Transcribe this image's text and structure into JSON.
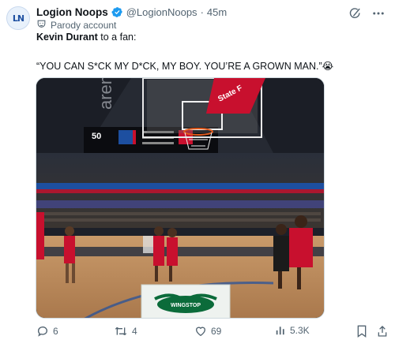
{
  "tweet": {
    "author": {
      "display_name": "Logion Noops",
      "handle": "@LogionNoops",
      "separator": "·",
      "time": "45m",
      "avatar_logo": "LN",
      "verified_icon": "verified-badge-icon",
      "parody_label": "Parody account"
    },
    "text": {
      "subject": "Kevin Durant",
      "rest": " to a fan:",
      "quote": "“YOU CAN S*CK MY D*CK, MY BOY. YOU’RE A GROWN MAN.”",
      "emoji": "😭"
    },
    "media": {
      "scoreboard_left": "50",
      "arena_word": "arena",
      "bottom_logo": "WINGSTOP",
      "banner_word": "State F"
    },
    "actions": {
      "replies": "6",
      "reposts": "4",
      "likes": "69",
      "views": "5.3K"
    }
  },
  "colors": {
    "accent": "#1d9bf0",
    "muted": "#536471",
    "text": "#0f1419",
    "court_red": "#c8102e"
  }
}
